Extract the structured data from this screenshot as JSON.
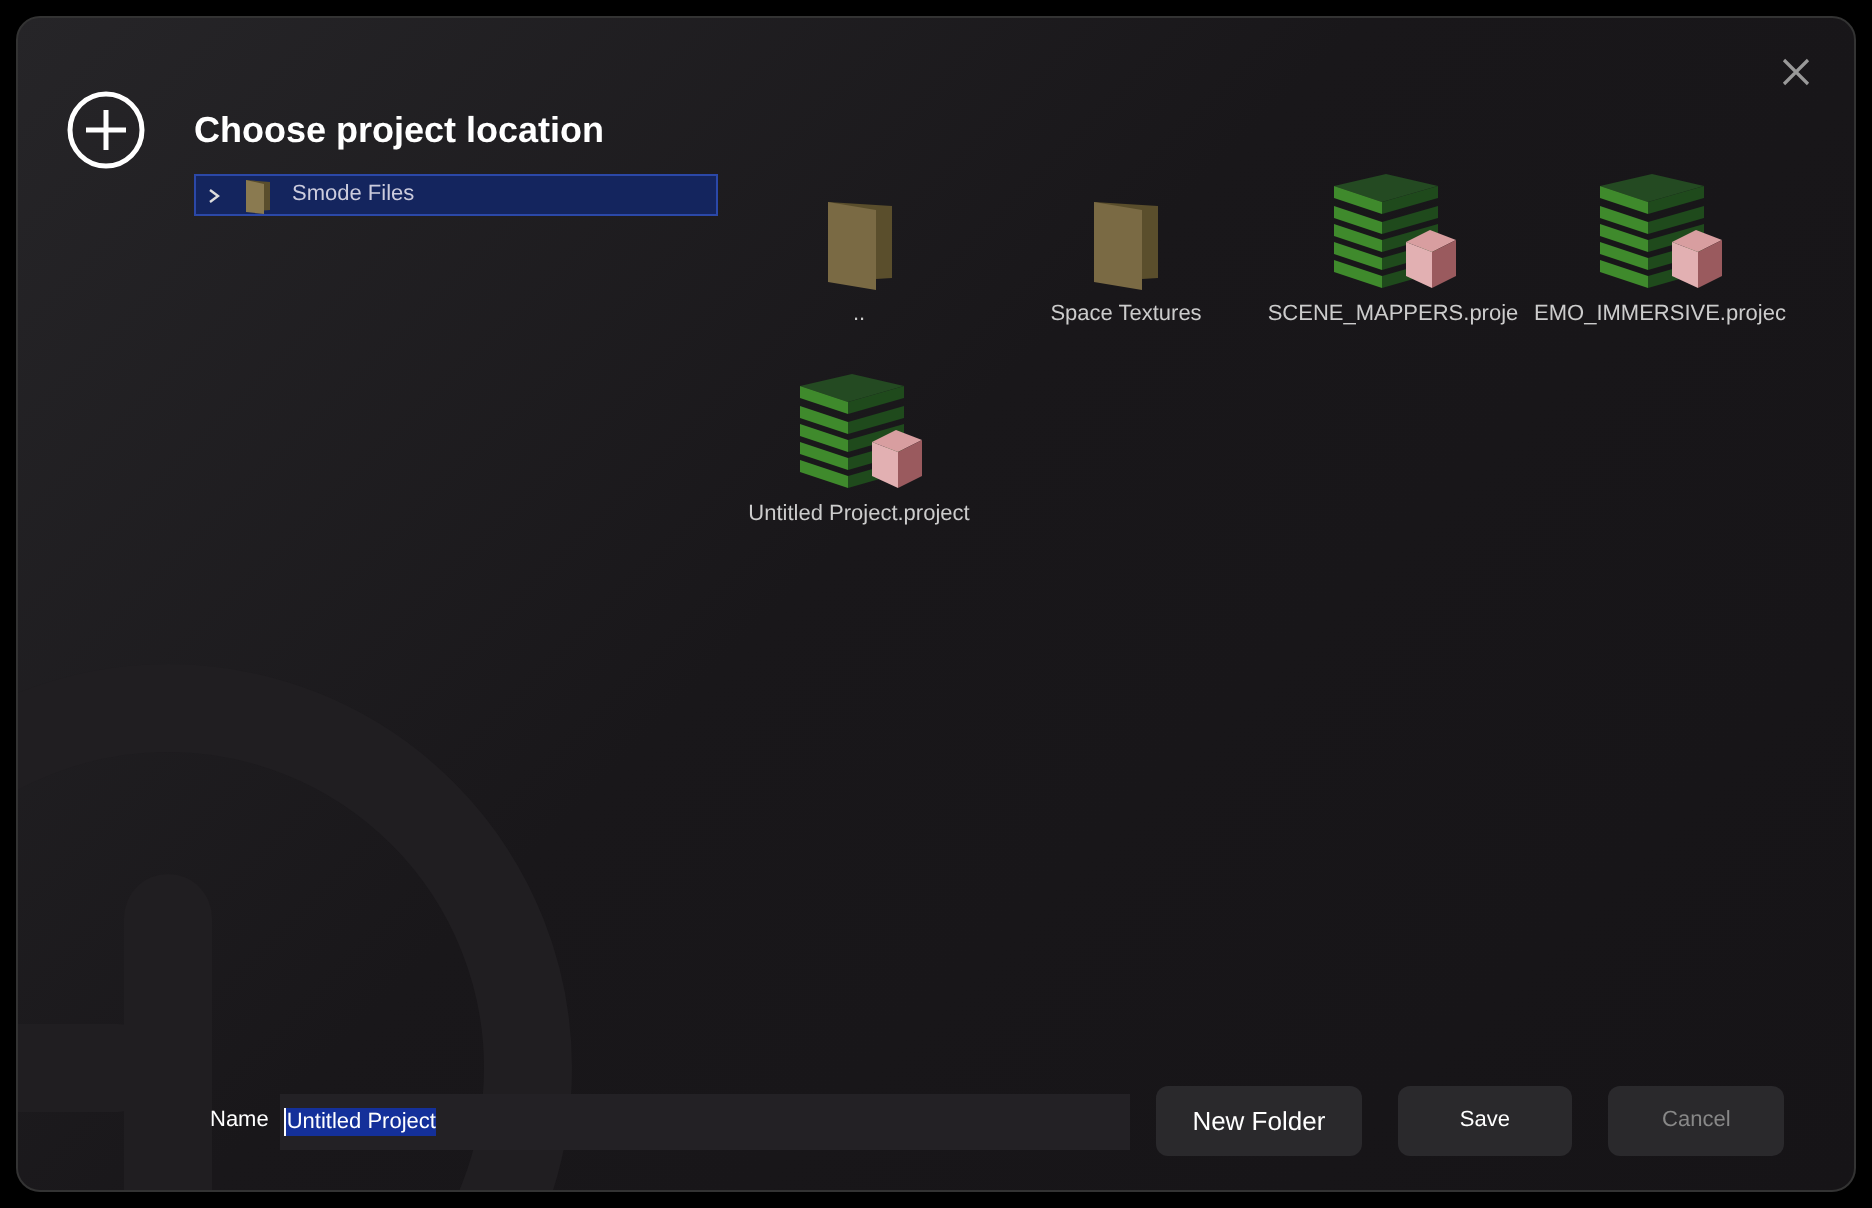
{
  "dialog": {
    "title": "Choose project location"
  },
  "tree": [
    {
      "label": "Smode Files",
      "selected": true,
      "expanded": false
    }
  ],
  "files": [
    {
      "kind": "folder",
      "label": ".."
    },
    {
      "kind": "folder",
      "label": "Space Textures"
    },
    {
      "kind": "project",
      "label": "SCENE_MAPPERS.proje"
    },
    {
      "kind": "project",
      "label": "EMO_IMMERSIVE.projec"
    },
    {
      "kind": "project",
      "label": "Untitled Project.project"
    }
  ],
  "name_field": {
    "label": "Name",
    "value": "Untitled Project",
    "value_selected": true
  },
  "buttons": [
    {
      "label": "New Folder",
      "disabled": false
    },
    {
      "label": "Save",
      "disabled": false
    },
    {
      "label": "Cancel",
      "disabled": true
    }
  ]
}
